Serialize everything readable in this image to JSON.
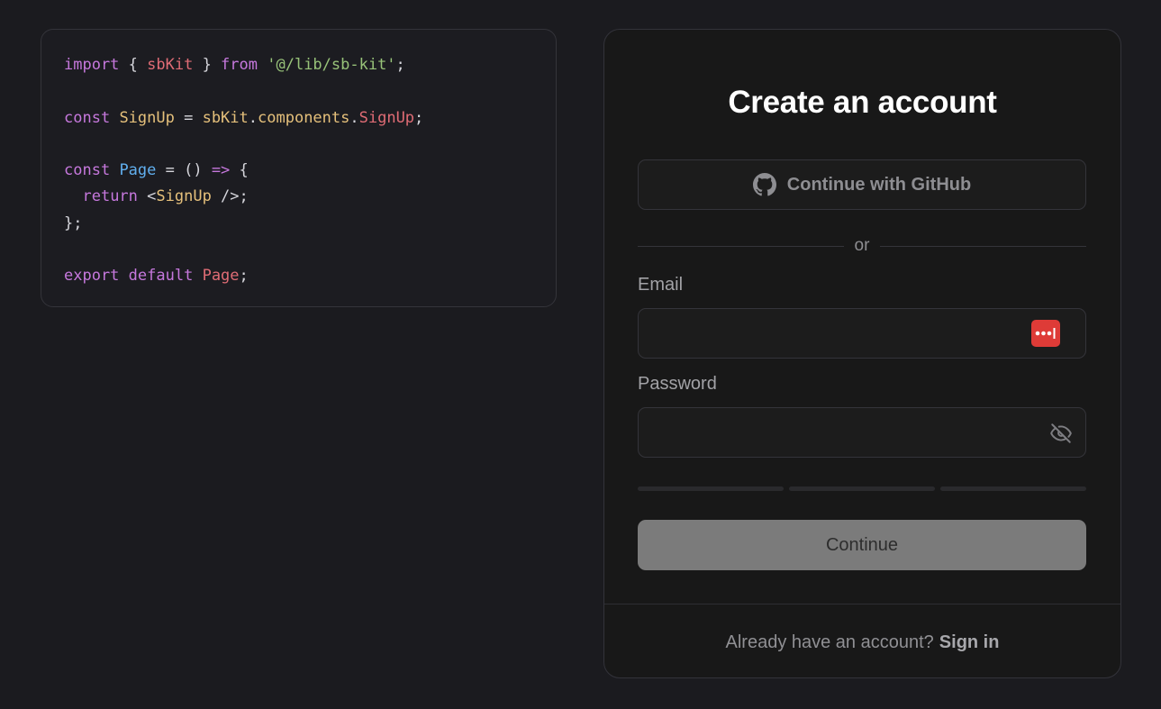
{
  "code": {
    "lines": [
      [
        {
          "t": "import",
          "c": "keyword"
        },
        {
          "t": " { ",
          "c": "punct"
        },
        {
          "t": "sbKit",
          "c": "import"
        },
        {
          "t": " } ",
          "c": "punct"
        },
        {
          "t": "from",
          "c": "keyword"
        },
        {
          "t": " ",
          "c": "punct"
        },
        {
          "t": "'@/lib/sb-kit'",
          "c": "string"
        },
        {
          "t": ";",
          "c": "punct"
        }
      ],
      [],
      [
        {
          "t": "const",
          "c": "keyword"
        },
        {
          "t": " ",
          "c": "punct"
        },
        {
          "t": "SignUp",
          "c": "ident"
        },
        {
          "t": " = ",
          "c": "punct"
        },
        {
          "t": "sbKit",
          "c": "ident"
        },
        {
          "t": ".",
          "c": "punct"
        },
        {
          "t": "components",
          "c": "ident"
        },
        {
          "t": ".",
          "c": "punct"
        },
        {
          "t": "SignUp",
          "c": "prop"
        },
        {
          "t": ";",
          "c": "punct"
        }
      ],
      [],
      [
        {
          "t": "const",
          "c": "keyword"
        },
        {
          "t": " ",
          "c": "punct"
        },
        {
          "t": "Page",
          "c": "page"
        },
        {
          "t": " = () ",
          "c": "punct"
        },
        {
          "t": "=>",
          "c": "arrow"
        },
        {
          "t": " {",
          "c": "punct"
        }
      ],
      [
        {
          "t": "  ",
          "c": "punct"
        },
        {
          "t": "return",
          "c": "keyword"
        },
        {
          "t": " <",
          "c": "punct"
        },
        {
          "t": "SignUp",
          "c": "ident"
        },
        {
          "t": " />;",
          "c": "punct"
        }
      ],
      [
        {
          "t": "};",
          "c": "punct"
        }
      ],
      [],
      [
        {
          "t": "export",
          "c": "keyword"
        },
        {
          "t": " ",
          "c": "punct"
        },
        {
          "t": "default",
          "c": "keyword"
        },
        {
          "t": " ",
          "c": "punct"
        },
        {
          "t": "Page",
          "c": "prop"
        },
        {
          "t": ";",
          "c": "punct"
        }
      ]
    ]
  },
  "signup": {
    "title": "Create an account",
    "github_label": "Continue with GitHub",
    "github_icon": "github-icon",
    "divider_text": "or",
    "email_label": "Email",
    "email_value": "",
    "password_manager_icon": "password-manager-icon",
    "password_label": "Password",
    "password_value": "",
    "visibility_icon": "eye-off-icon",
    "strength_segments_filled": 0,
    "continue_label": "Continue",
    "footer_prompt": "Already have an account?",
    "footer_link": "Sign in"
  },
  "colors": {
    "background": "#1b1b1f",
    "card": "#181818",
    "password_manager_red": "#de3b37",
    "continue_disabled": "#7b7b7b"
  }
}
